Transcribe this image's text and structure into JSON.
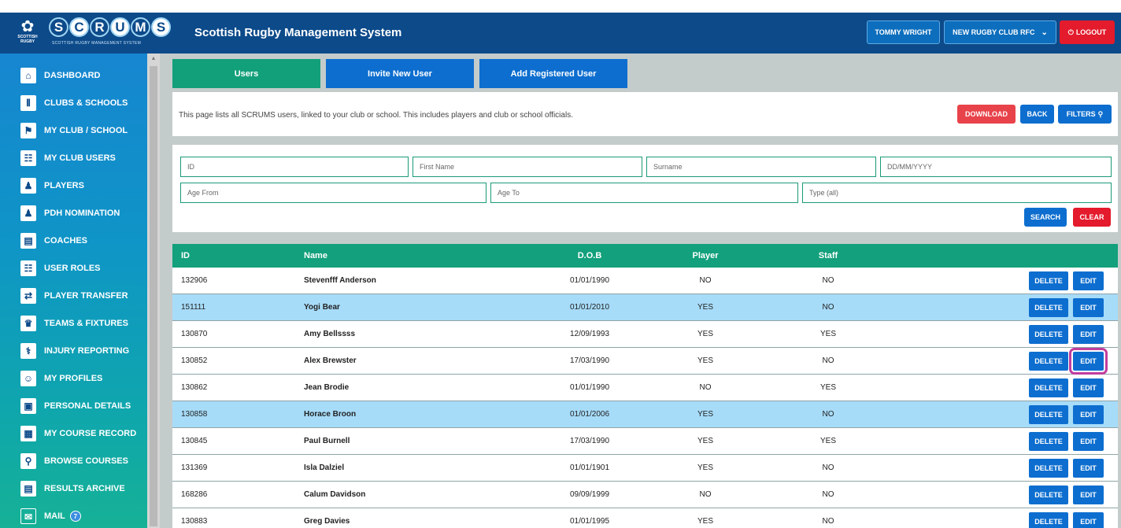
{
  "header": {
    "logo_text": "SCRUMS",
    "logo_subtitle": "SCOTTISH RUGBY MANAGEMENT SYSTEM",
    "logo_mark_text": "SCOTTISH RUGBY",
    "title": "Scottish Rugby Management System",
    "user": "TOMMY WRIGHT",
    "club": "NEW RUGBY CLUB RFC",
    "logout": "LOGOUT"
  },
  "sidebar": {
    "items": [
      {
        "label": "DASHBOARD",
        "icon": "home-icon"
      },
      {
        "label": "CLUBS & SCHOOLS",
        "icon": "goalposts-icon"
      },
      {
        "label": "MY CLUB / SCHOOL",
        "icon": "club-icon"
      },
      {
        "label": "MY CLUB USERS",
        "icon": "users-icon"
      },
      {
        "label": "PLAYERS",
        "icon": "player-icon"
      },
      {
        "label": "PDH NOMINATION",
        "icon": "nomination-icon"
      },
      {
        "label": "COACHES",
        "icon": "clipboard-icon"
      },
      {
        "label": "USER ROLES",
        "icon": "roles-icon"
      },
      {
        "label": "PLAYER TRANSFER",
        "icon": "transfer-icon"
      },
      {
        "label": "TEAMS & FIXTURES",
        "icon": "trophy-icon"
      },
      {
        "label": "INJURY REPORTING",
        "icon": "ambulance-icon"
      },
      {
        "label": "MY PROFILES",
        "icon": "profile-icon"
      },
      {
        "label": "PERSONAL DETAILS",
        "icon": "details-icon"
      },
      {
        "label": "MY COURSE RECORD",
        "icon": "course-record-icon"
      },
      {
        "label": "BROWSE COURSES",
        "icon": "browse-icon"
      },
      {
        "label": "RESULTS ARCHIVE",
        "icon": "archive-icon"
      },
      {
        "label": "MAIL",
        "icon": "mail-icon",
        "badge": "7"
      }
    ]
  },
  "tabs": {
    "users": "Users",
    "invite": "Invite New User",
    "add_registered": "Add Registered User"
  },
  "info": {
    "text": "This page lists all SCRUMS users, linked to your club or school. This includes players and club or school officials.",
    "download": "DOWNLOAD",
    "back": "BACK",
    "filters": "FILTERS"
  },
  "filters": {
    "id": "ID",
    "first_name": "First Name",
    "surname": "Surname",
    "dob": "DD/MM/YYYY",
    "age_from": "Age From",
    "age_to": "Age To",
    "type": "Type (all)",
    "search": "SEARCH",
    "clear": "CLEAR"
  },
  "table": {
    "columns": [
      "ID",
      "Name",
      "D.O.B",
      "Player",
      "Staff"
    ],
    "delete_label": "DELETE",
    "edit_label": "EDIT",
    "rows": [
      {
        "id": "132906",
        "name": "Stevenfff Anderson",
        "dob": "01/01/1990",
        "player": "NO",
        "staff": "NO"
      },
      {
        "id": "151111",
        "name": "Yogi Bear",
        "dob": "01/01/2010",
        "player": "YES",
        "staff": "NO"
      },
      {
        "id": "130870",
        "name": "Amy Bellssss",
        "dob": "12/09/1993",
        "player": "YES",
        "staff": "YES"
      },
      {
        "id": "130852",
        "name": "Alex Brewster",
        "dob": "17/03/1990",
        "player": "YES",
        "staff": "NO"
      },
      {
        "id": "130862",
        "name": "Jean Brodie",
        "dob": "01/01/1990",
        "player": "NO",
        "staff": "YES"
      },
      {
        "id": "130858",
        "name": "Horace Broon",
        "dob": "01/01/2006",
        "player": "YES",
        "staff": "NO"
      },
      {
        "id": "130845",
        "name": "Paul Burnell",
        "dob": "17/03/1990",
        "player": "YES",
        "staff": "YES"
      },
      {
        "id": "131369",
        "name": "Isla Dalziel",
        "dob": "01/01/1901",
        "player": "YES",
        "staff": "NO"
      },
      {
        "id": "168286",
        "name": "Calum Davidson",
        "dob": "09/09/1999",
        "player": "NO",
        "staff": "NO"
      },
      {
        "id": "130883",
        "name": "Greg Davies",
        "dob": "01/01/1995",
        "player": "YES",
        "staff": "NO"
      }
    ]
  },
  "colors": {
    "header_bg": "#0c4a8a",
    "primary_blue": "#0d6ecf",
    "green": "#13a07c",
    "red": "#e31b2c",
    "row_highlight": "#a7dcf9",
    "annotation": "#c13d9e"
  }
}
